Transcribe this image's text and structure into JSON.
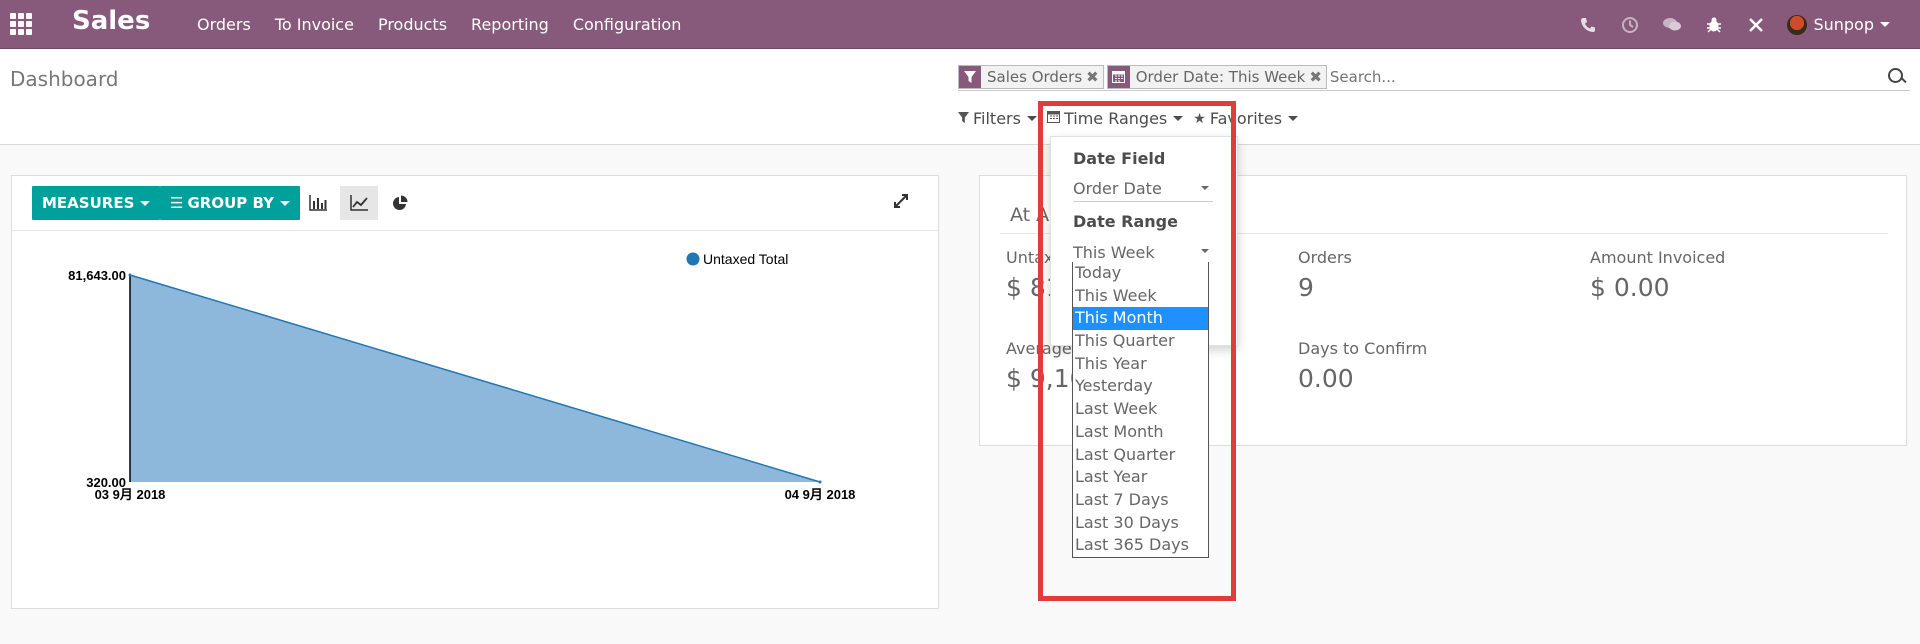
{
  "navbar": {
    "app_name": "Sales",
    "menu": [
      "Orders",
      "To Invoice",
      "Products",
      "Reporting",
      "Configuration"
    ],
    "systray_icons": [
      "phone-icon",
      "clock-icon",
      "chat-icon",
      "bug-icon",
      "tools-icon"
    ],
    "user_name": "Sunpop"
  },
  "control_panel": {
    "breadcrumb": "Dashboard",
    "facets": [
      {
        "icon": "filter-icon",
        "label": "Sales Orders"
      },
      {
        "icon": "calendar-icon",
        "label": "Order Date: This Week"
      }
    ],
    "search_placeholder": "Search...",
    "options": {
      "filters": "Filters",
      "time_ranges": "Time Ranges",
      "favorites": "Favorites"
    }
  },
  "graph": {
    "measures_label": "MEASURES",
    "group_by_label": "GROUP BY",
    "views": [
      "bar-chart-icon",
      "line-chart-icon",
      "pie-chart-icon"
    ],
    "active_view": "line-chart-icon"
  },
  "chart_data": {
    "type": "area",
    "categories": [
      "03 9月 2018",
      "04 9月 2018"
    ],
    "series": [
      {
        "name": "Untaxed Total",
        "values": [
          81643.0,
          320.0
        ]
      }
    ],
    "y_tick_labels": [
      "81,643.00",
      "320.00"
    ],
    "ylim": [
      320.0,
      81643.0
    ],
    "legend_position": "top-right",
    "color": "#8db8db",
    "line_color": "#1f77b4",
    "legend_dot_color": "#1f77b4"
  },
  "aggregates": {
    "title": "At A",
    "stats": [
      {
        "label": "Untax",
        "value": "$ 81"
      },
      {
        "label": "Orders",
        "value": "9"
      },
      {
        "label": "Amount Invoiced",
        "value": "$ 0.00"
      },
      {
        "label": "Average",
        "value": "$ 9,10"
      },
      {
        "label": "Days to Confirm",
        "value": "0.00"
      }
    ]
  },
  "time_ranges_dropdown": {
    "date_field_heading": "Date Field",
    "date_field_value": "Order Date",
    "date_range_heading": "Date Range",
    "date_range_value": "This Week",
    "highlighted_option": "This Month",
    "options": [
      "Today",
      "This Week",
      "This Month",
      "This Quarter",
      "This Year",
      "Yesterday",
      "Last Week",
      "Last Month",
      "Last Quarter",
      "Last Year",
      "Last 7 Days",
      "Last 30 Days",
      "Last 365 Days"
    ]
  },
  "colors": {
    "navbar": "#875a7b",
    "primary_button": "#00a09d",
    "highlight_box": "#e23b3b",
    "selected_option": "#1e90ff"
  }
}
